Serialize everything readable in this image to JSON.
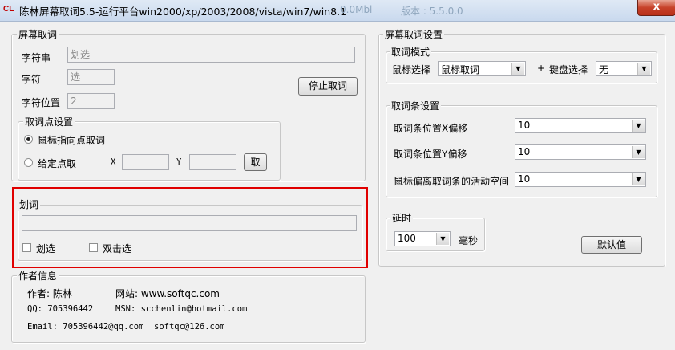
{
  "window": {
    "app_icon": "CL",
    "title": "陈林屏幕取词5.5-运行平台win2000/xp/2003/2008/vista/win7/win8.1",
    "ghost_a": "0.0Mbl",
    "ghost_b": "版本 : 5.5.0.0",
    "close_glyph": "x"
  },
  "capture": {
    "legend": "屏幕取词",
    "string_label": "字符串",
    "string_value": "划选",
    "char_label": "字符",
    "char_value": "选",
    "pos_label": "字符位置",
    "pos_value": "2",
    "stop_button": "停止取词"
  },
  "point": {
    "legend": "取词点设置",
    "radio_pointer": "鼠标指向点取词",
    "radio_given": "给定点取",
    "x_label": "X",
    "y_label": "Y",
    "x_value": "",
    "y_value": "",
    "pick_button": "取"
  },
  "stroke": {
    "legend": "划词",
    "value": "",
    "check_select": "划选",
    "check_double": "双击选"
  },
  "author": {
    "legend": "作者信息",
    "author": "作者: 陈林",
    "website": "网站: www.softqc.com",
    "qq": "QQ: 705396442",
    "msn": "MSN: scchenlin@hotmail.com",
    "email": "Email: 705396442@qq.com",
    "email2": "softqc@126.com"
  },
  "settings": {
    "legend": "屏幕取词设置",
    "mode_legend": "取词模式",
    "mouse_label": "鼠标选择",
    "mouse_value": "鼠标取词",
    "plus": "+",
    "keyboard_label": "键盘选择",
    "keyboard_value": "无",
    "bar_legend": "取词条设置",
    "x_offset_label": "取词条位置X偏移",
    "x_offset_value": "10",
    "y_offset_label": "取词条位置Y偏移",
    "y_offset_value": "10",
    "space_label": "鼠标偏离取词条的活动空间",
    "space_value": "10",
    "delay_legend": "延时",
    "delay_value": "100",
    "delay_unit": "毫秒",
    "default_button": "默认值"
  }
}
